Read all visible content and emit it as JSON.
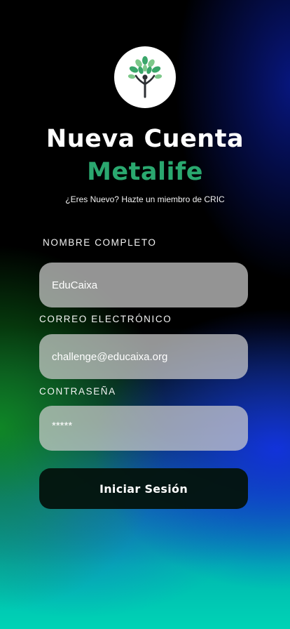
{
  "header": {
    "logo_icon": "tree-person-icon",
    "title": "Nueva Cuenta",
    "brand": "Metalife",
    "subtitle": "¿Eres Nuevo? Hazte un miembro de CRIC"
  },
  "form": {
    "name_label": "NOMBRE COMPLETO",
    "name_value": "EduCaixa",
    "email_label": "CORREO ELECTRÓNICO",
    "email_value": "challenge@educaixa.org",
    "password_label": "CONTRASEÑA",
    "password_value": "*****",
    "submit_label": "Iniciar Sesión"
  },
  "colors": {
    "brand": "#2aa86f",
    "leaf_primary": "#3aa66a",
    "leaf_secondary": "#7dc88a",
    "button_bg": "#04140e"
  }
}
